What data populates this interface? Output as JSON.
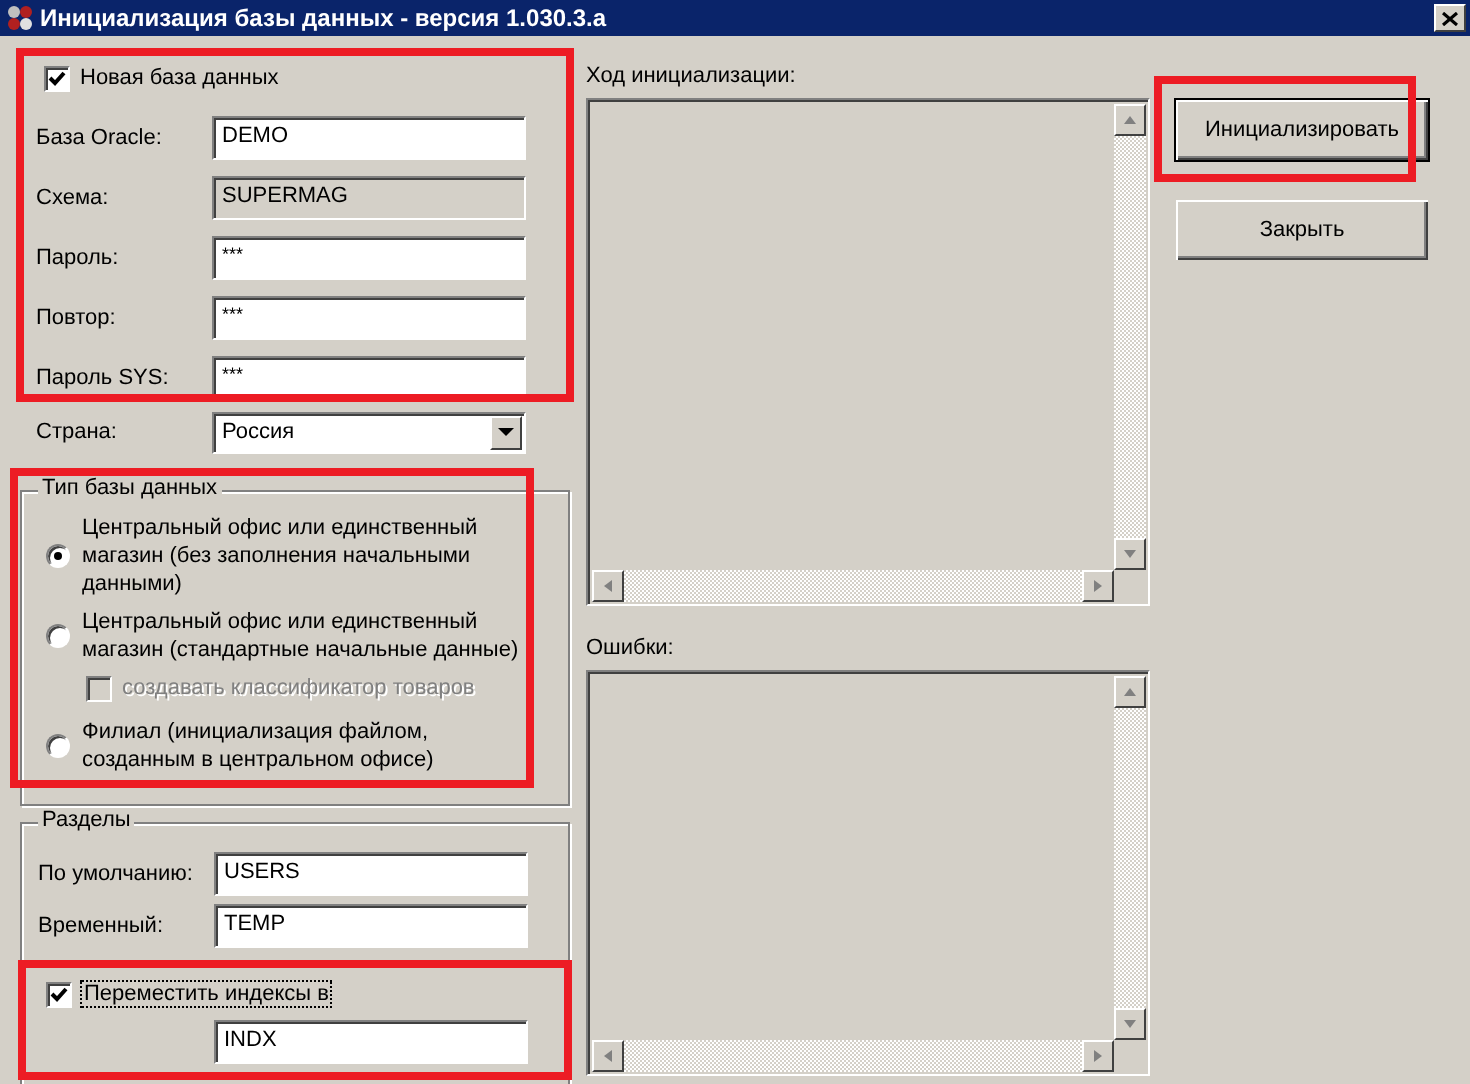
{
  "window": {
    "title": "Инициализация базы данных - версия 1.030.3.a"
  },
  "login": {
    "highlighted": true,
    "new_database": {
      "label": "Новая база данных",
      "checked": true
    },
    "fields": [
      {
        "label": "База Oracle:",
        "value": "DEMO",
        "disabled": false
      },
      {
        "label": "Схема:",
        "value": "SUPERMAG",
        "disabled": true
      },
      {
        "label": "Пароль:",
        "value": "***",
        "disabled": false
      },
      {
        "label": "Повтор:",
        "value": "***",
        "disabled": false
      },
      {
        "label": "Пароль SYS:",
        "value": "***",
        "disabled": false
      }
    ]
  },
  "country": {
    "label": "Страна:",
    "value": "Россия"
  },
  "db_type": {
    "title": "Тип базы данных",
    "highlighted": true,
    "options": [
      {
        "label": "Центральный офис или единственный магазин (без заполнения начальными данными)",
        "selected": true
      },
      {
        "label": "Центральный офис или единственный магазин (стандартные начальные данные)",
        "selected": false,
        "sub_option": {
          "label": "создавать классификатор товаров",
          "checked": false,
          "disabled": true
        }
      },
      {
        "label": "Филиал (инициализация файлом, созданным в центральном офисе)",
        "selected": false
      }
    ]
  },
  "sections": {
    "title": "Разделы",
    "fields": [
      {
        "label": "По умолчанию:",
        "value": "USERS"
      },
      {
        "label": "Временный:",
        "value": "TEMP"
      }
    ],
    "move_indexes": {
      "label": "Переместить индексы в",
      "checked": true,
      "focused": true,
      "highlighted": true,
      "value": "INDX"
    }
  },
  "progress": {
    "label": "Ход инициализации:"
  },
  "errors": {
    "label": "Ошибки:"
  },
  "buttons": [
    {
      "label": "Инициализировать",
      "default": true,
      "highlighted": true
    },
    {
      "label": "Закрыть",
      "default": false,
      "highlighted": false
    }
  ]
}
